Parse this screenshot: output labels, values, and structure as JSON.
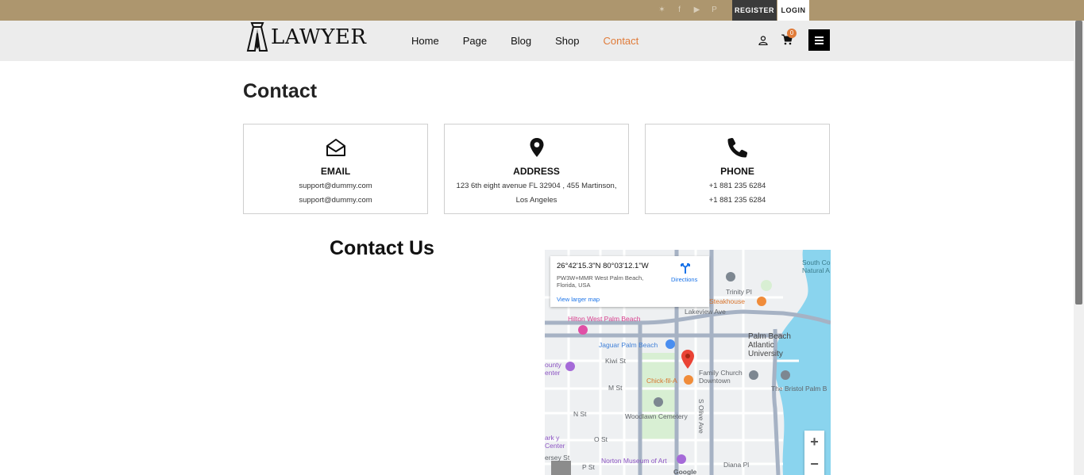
{
  "topbar": {
    "social": [
      {
        "icon": "twitter-icon",
        "glyph": "✶"
      },
      {
        "icon": "facebook-icon",
        "glyph": "f"
      },
      {
        "icon": "youtube-icon",
        "glyph": "▶"
      },
      {
        "icon": "pinterest-icon",
        "glyph": "P"
      }
    ],
    "register": "REGISTER",
    "login": "LOGIN"
  },
  "nav": {
    "logo": "LAWYER",
    "menu": [
      {
        "label": "Home",
        "active": false
      },
      {
        "label": "Page",
        "active": false
      },
      {
        "label": "Blog",
        "active": false
      },
      {
        "label": "Shop",
        "active": false
      },
      {
        "label": "Contact",
        "active": true
      }
    ],
    "cart_count": "0"
  },
  "page": {
    "title": "Contact",
    "contact_us": "Contact Us"
  },
  "cards": [
    {
      "title": "EMAIL",
      "lines": [
        "support@dummy.com",
        "support@dummy.com"
      ],
      "icon": "envelope-open-icon"
    },
    {
      "title": "ADDRESS",
      "lines": [
        "123 6th eight avenue FL 32904 , 455 Martinson,",
        "Los Angeles"
      ],
      "icon": "map-pin-icon"
    },
    {
      "title": "PHONE",
      "lines": [
        "+1 881 235 6284",
        "+1 881 235 6284"
      ],
      "icon": "phone-icon"
    }
  ],
  "map": {
    "coords": "26°42'15.3\"N 80°03'12.1\"W",
    "plus_code": "PW3W+MMR West Palm Beach, Florida, USA",
    "directions": "Directions",
    "view_larger": "View larger map",
    "labels": {
      "lakeview": "Lakeview Ave",
      "hilton": "Hilton West Palm Beach",
      "jaguar": "Jaguar Palm Beach",
      "kiwi": "Kiwi St",
      "mst": "M St",
      "nst": "N St",
      "ost": "O St",
      "pst": "P St",
      "palmbeach": "Palm Beach Atlantic University",
      "family": "Family Church Downtown",
      "chick": "Chick-fil-A",
      "woodlawn": "Woodlawn Cemetery",
      "norton": "Norton Museum of Art",
      "bristol": "The Bristol Palm B",
      "diana": "Diana Pl",
      "trinity": "Trinity Pl",
      "steakhouse": "e Steakhouse",
      "southcove": "South Co Natural A",
      "olive": "S Olive Ave",
      "county": "ounty enter",
      "park": "ark y Center",
      "jersey": "ersey St",
      "google": "Google"
    },
    "zoom_in": "+",
    "zoom_out": "−"
  },
  "colors": {
    "topbar": "#ad966e",
    "accent": "#e07b39",
    "water": "#8ad4ee",
    "park": "#d8efd3"
  }
}
